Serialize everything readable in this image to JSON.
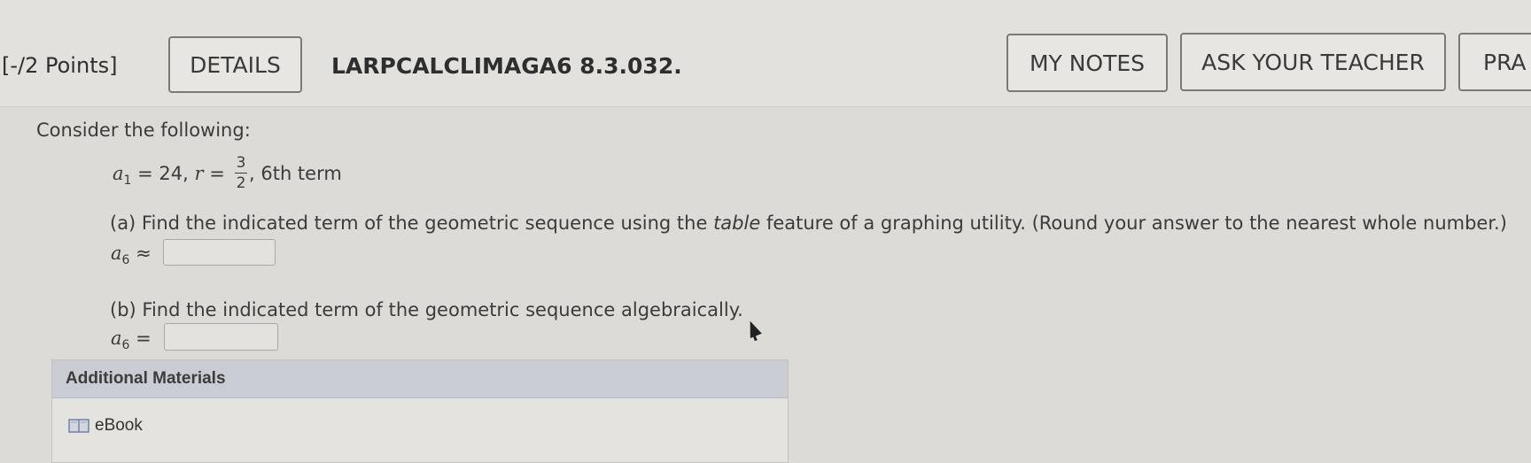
{
  "header": {
    "points": "[-/2 Points]",
    "details_label": "DETAILS",
    "problem_code": "LARPCALCLIMAGA6 8.3.032.",
    "my_notes_label": "MY NOTES",
    "ask_teacher_label": "ASK YOUR TEACHER",
    "practice_label": "PRA"
  },
  "question": {
    "intro": "Consider the following:",
    "given": {
      "a_symbol": "a",
      "a_subscript": "1",
      "a_value": "= 24,",
      "r_symbol": "r",
      "r_equals": "=",
      "r_numerator": "3",
      "r_denominator": "2",
      "term_text": ", 6th term"
    },
    "part_a": {
      "prompt_prefix": "(a) Find the indicated term of the geometric sequence using the ",
      "prompt_emphasis": "table",
      "prompt_suffix": " feature of a graphing utility. (Round your answer to the nearest whole number.)",
      "label_symbol": "a",
      "label_subscript": "6",
      "relation": "≈",
      "answer_value": ""
    },
    "part_b": {
      "prompt": "(b) Find the indicated term of the geometric sequence algebraically.",
      "label_symbol": "a",
      "label_subscript": "6",
      "relation": "=",
      "answer_value": ""
    }
  },
  "materials": {
    "title": "Additional Materials",
    "ebook_label": "eBook",
    "ebook_icon": "book-icon"
  }
}
